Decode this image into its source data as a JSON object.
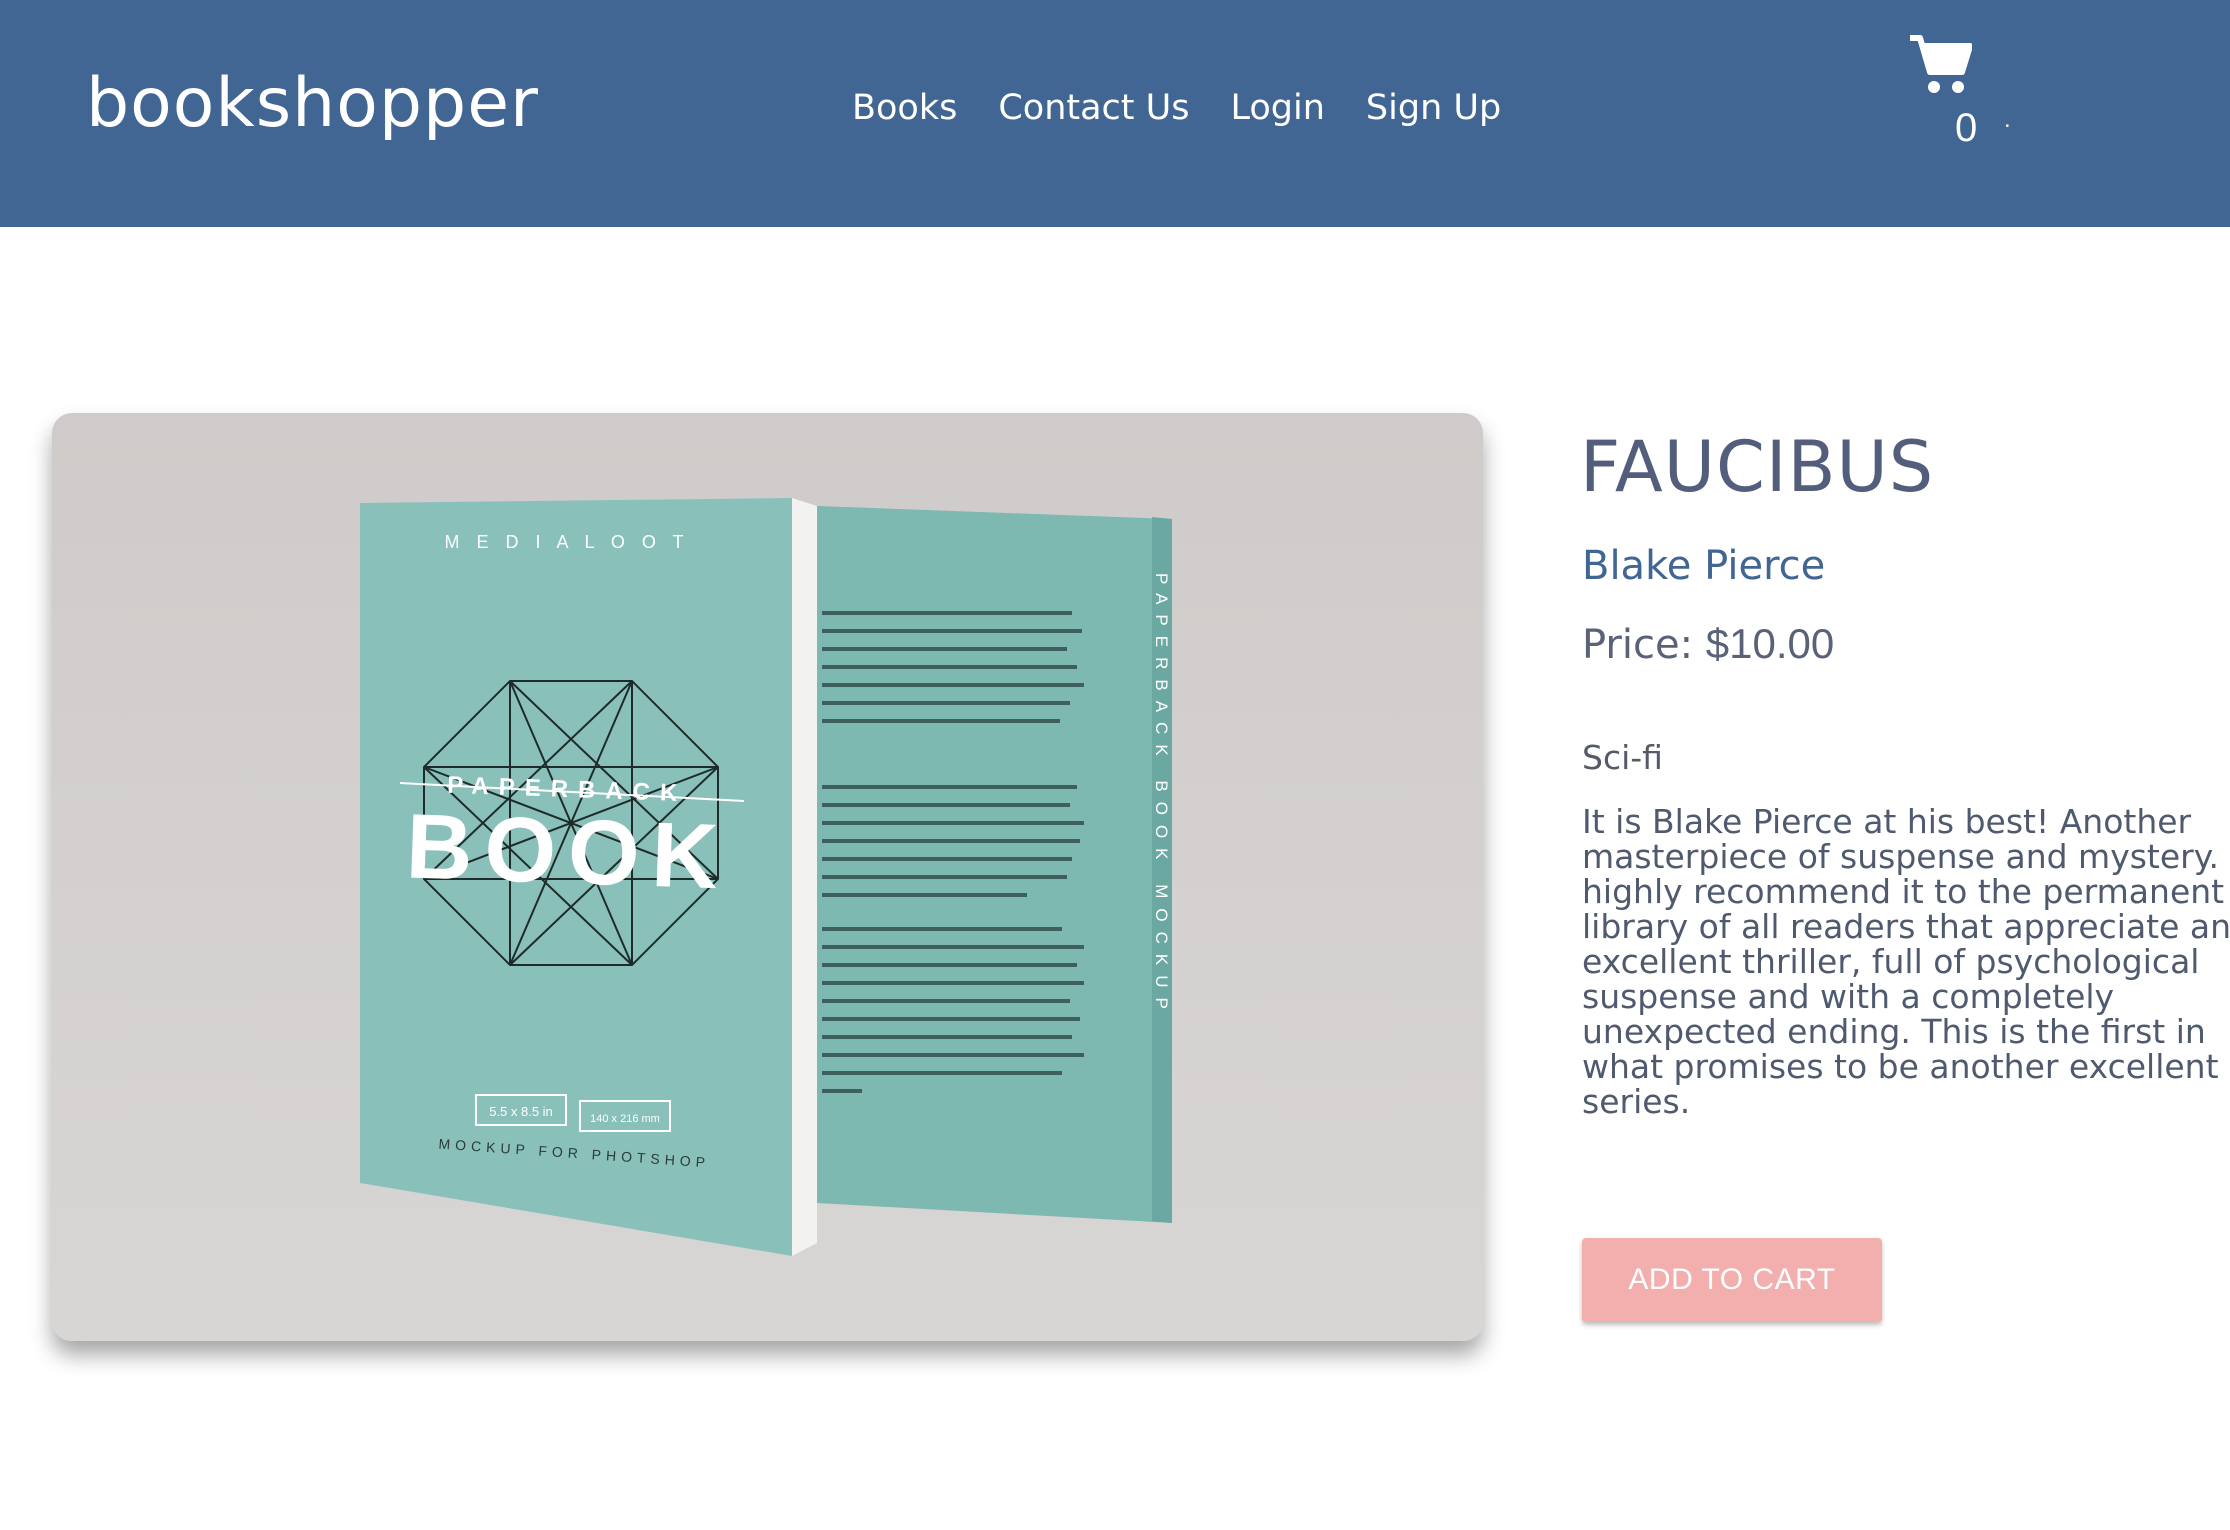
{
  "header": {
    "logo": "bookshopper",
    "nav": [
      "Books",
      "Contact Us",
      "Login",
      "Sign Up"
    ],
    "cart_count": "0",
    "cart_icon": "shopping-cart-icon",
    "background_color": "#416694"
  },
  "product": {
    "image_text": {
      "brand": "M E D I A L O O T",
      "subtitle": "PAPERBACK",
      "big_title": "BOOK",
      "size_in": "5.5 x 8.5 in",
      "size_mm": "140 x 216 mm",
      "footer": "MOCKUP FOR PHOTSHOP",
      "spine": "PAPERBACK BOOK MOCKUP"
    },
    "title": "FAUCIBUS",
    "author": "Blake Pierce",
    "price_label": "Price:",
    "price_value": "$10.00",
    "genre": "Sci-fi",
    "description": "It is Blake Pierce at his best! Another masterpiece of suspense and mystery. I highly recommend it to the permanent library of all readers that appreciate an excellent thriller, full of psychological suspense and with a completely unexpected ending. This is the first in what promises to be another excellent series.",
    "add_to_cart_label": "ADD TO CART",
    "button_color": "#f3aeae"
  }
}
